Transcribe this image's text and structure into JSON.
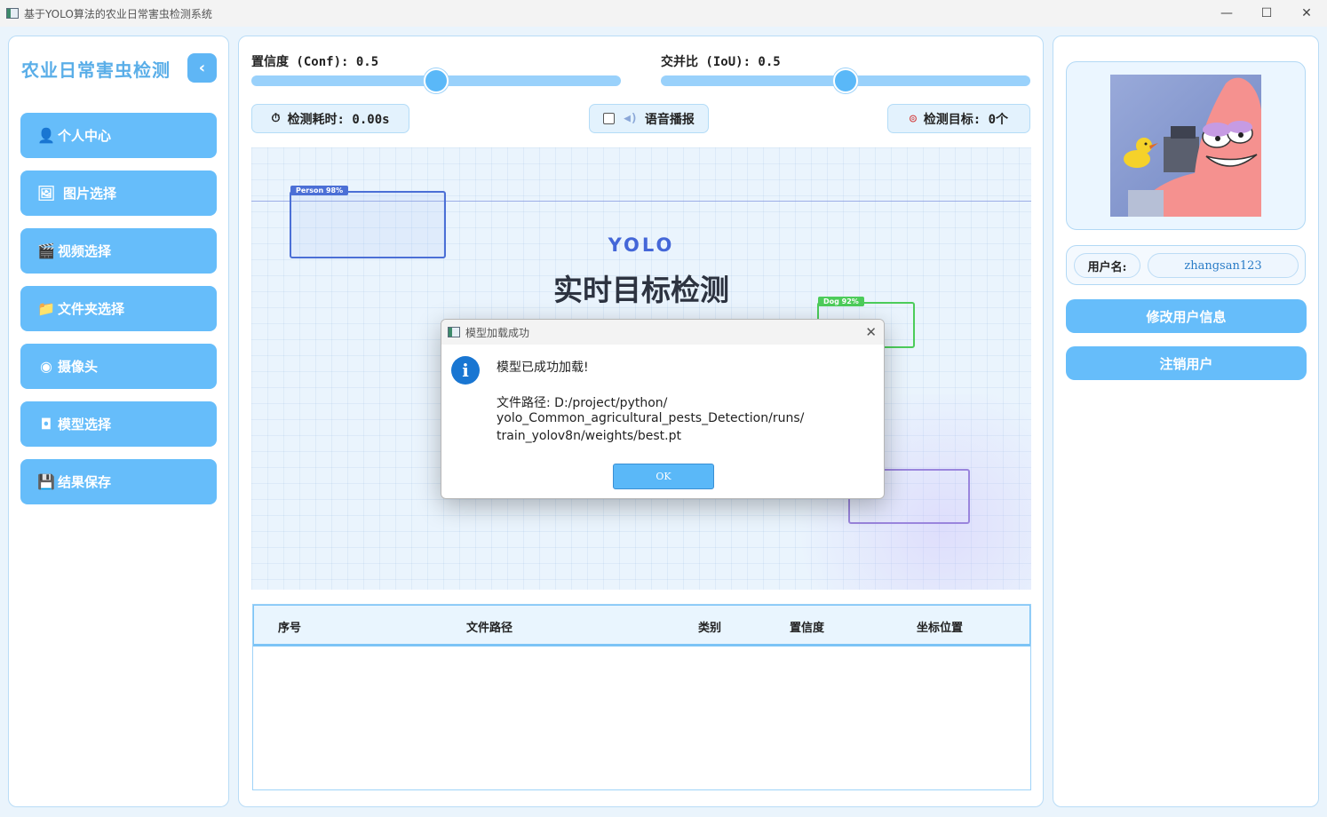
{
  "window": {
    "title": "基于YOLO算法的农业日常害虫检测系统",
    "min_glyph": "—",
    "max_glyph": "☐",
    "close_glyph": "✕"
  },
  "sidebar": {
    "title": "农业日常害虫检测",
    "collapse_glyph": "‹",
    "items": [
      {
        "label": "个人中心",
        "icon": "user-icon",
        "glyph": "👤"
      },
      {
        "label": "图片选择",
        "icon": "image-icon",
        "glyph": "🖼"
      },
      {
        "label": "视频选择",
        "icon": "clapperboard-icon",
        "glyph": "🎬"
      },
      {
        "label": "文件夹选择",
        "icon": "folder-icon",
        "glyph": "📁"
      },
      {
        "label": "摄像头",
        "icon": "webcam-icon",
        "glyph": "◉"
      },
      {
        "label": "模型选择",
        "icon": "robot-icon",
        "glyph": "◘"
      },
      {
        "label": "结果保存",
        "icon": "floppy-icon",
        "glyph": "💾"
      }
    ]
  },
  "controls": {
    "conf_label": "置信度 (Conf): 0.5",
    "conf_value": 0.5,
    "iou_label": "交并比 (IoU): 0.5",
    "iou_value": 0.5,
    "time_label": "检测耗时: 0.00s",
    "time_icon": "stopwatch-icon",
    "voice_label": "语音播报",
    "voice_icon": "speaker-icon",
    "voice_checked": false,
    "target_label": "检测目标: 0个",
    "target_icon": "target-icon"
  },
  "preview": {
    "brand": "YOLO",
    "headline": "实时目标检测",
    "tags": {
      "person": "Person 98%",
      "dog": "Dog 92%"
    }
  },
  "table": {
    "headers": [
      "序号",
      "文件路径",
      "类别",
      "置信度",
      "坐标位置"
    ],
    "rows": []
  },
  "user": {
    "label": "用户名:",
    "username": "zhangsan123",
    "edit_button": "修改用户信息",
    "logout_button": "注销用户"
  },
  "dialog": {
    "title": "模型加载成功",
    "message": "模型已成功加载!",
    "path_line1": "文件路径: D:/project/python/",
    "path_line2": "yolo_Common_agricultural_pests_Detection/runs/",
    "path_line3": "train_yolov8n/weights/best.pt",
    "ok_label": "OK",
    "icon": "info-icon",
    "close_glyph": "✕"
  },
  "colors": {
    "accent": "#66bdfa",
    "title": "#5aaee8",
    "dialog_icon": "#1976d2"
  }
}
